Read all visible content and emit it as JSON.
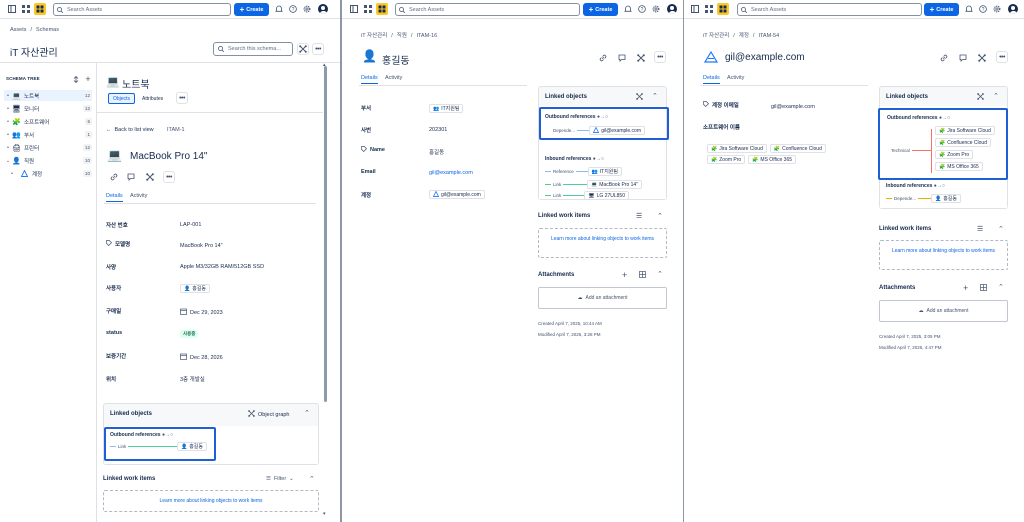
{
  "topbar": {
    "search_placeholder": "Search Assets",
    "create_label": "Create"
  },
  "panel1": {
    "breadcrumb": [
      "Assets",
      "Schemas"
    ],
    "schema_title": "iT 자산관리",
    "schema_search_placeholder": "Search this schema...",
    "schema_tree_label": "SCHEMA TREE",
    "tree": [
      {
        "label": "노트북",
        "count": "12",
        "icon": "laptop-icon",
        "selected": true
      },
      {
        "label": "모니터",
        "count": "12",
        "icon": "monitor-icon"
      },
      {
        "label": "소프트웨어",
        "count": "6",
        "icon": "software-icon"
      },
      {
        "label": "부서",
        "count": "1",
        "icon": "department-icon"
      },
      {
        "label": "프린터",
        "count": "12",
        "icon": "printer-icon"
      },
      {
        "label": "직원",
        "count": "10",
        "icon": "employee-icon",
        "expanded": true
      },
      {
        "label": "계정",
        "count": "10",
        "icon": "account-icon",
        "child": true
      }
    ],
    "type_title": "노트북",
    "type_tabs": {
      "objects": "Objects",
      "attributes": "Attributes"
    },
    "back_label": "Back to list view",
    "object_key": "ITAM-1",
    "object_title": "MacBook Pro 14\"",
    "detail_tabs": {
      "details": "Details",
      "activity": "Activity"
    },
    "attributes": [
      {
        "label": "자산 번호",
        "value": "LAP-001"
      },
      {
        "label": "모델명",
        "value": "MacBook Pro 14\""
      },
      {
        "label": "사양",
        "value": "Apple M3/32GB RAM/512GB SSD"
      },
      {
        "label": "사용자",
        "value": "홍길동"
      },
      {
        "label": "구매일",
        "value": "Dec 29, 2023"
      },
      {
        "label": "status",
        "value": "사용중"
      },
      {
        "label": "보증기간",
        "value": "Dec 28, 2026"
      },
      {
        "label": "위치",
        "value": "3층 개발실"
      }
    ],
    "linked_objects_title": "Linked objects",
    "object_graph_label": "Object graph",
    "outbound_title": "Outbound references",
    "outbound_link_label": "Link",
    "outbound_target": "홍길동",
    "work_items_title": "Linked work items",
    "filter_label": "Filter",
    "work_items_link": "Learn more about linking objects to work items"
  },
  "panel2": {
    "breadcrumb": [
      "iT 자산관리",
      "직원",
      "ITAM-16"
    ],
    "object_title": "홍길동",
    "detail_tabs": {
      "details": "Details",
      "activity": "Activity"
    },
    "attributes": [
      {
        "label": "부서",
        "value": "IT지원팀"
      },
      {
        "label": "사번",
        "value": "202301"
      },
      {
        "label": "Name",
        "value": "홍길동"
      },
      {
        "label": "Email",
        "value": "gil@example.com"
      },
      {
        "label": "계정",
        "value": "gil@example.com"
      }
    ],
    "linked_objects_title": "Linked objects",
    "outbound_title": "Outbound references",
    "outbound_label": "Depende...",
    "outbound_target": "gil@example.com",
    "inbound_title": "Inbound references",
    "inbound": [
      {
        "label": "Reference",
        "targets": [
          "IT지원팀"
        ]
      },
      {
        "label": "Link",
        "targets": [
          "MacBook Pro 14\"",
          "LG 27UL850"
        ]
      }
    ],
    "work_items_title": "Linked work items",
    "work_items_link": "Learn more about linking objects to work items",
    "attachments_title": "Attachments",
    "add_attachment": "Add an attachment",
    "created": "Created April 7, 2025, 10:44 AM",
    "modified": "Modified April 7, 2025, 3:28 PM"
  },
  "panel3": {
    "breadcrumb": [
      "iT 자산관리",
      "계정",
      "ITAM-54"
    ],
    "object_title": "gil@example.com",
    "detail_tabs": {
      "details": "Details",
      "activity": "Activity"
    },
    "email_label": "계정 이메일",
    "email_value": "gil@example.com",
    "software_label": "소프트웨어 이름",
    "software": [
      "Jira Software Cloud",
      "Confluence Cloud",
      "Zoom Pro",
      "MS Office 365"
    ],
    "linked_objects_title": "Linked objects",
    "outbound_title": "Outbound references",
    "outbound_label": "Technical",
    "outbound_targets": [
      "Jira Software Cloud",
      "Confluence Cloud",
      "Zoom Pro",
      "MS Office 365"
    ],
    "inbound_title": "Inbound references",
    "inbound_label": "Depende...",
    "inbound_target": "홍길동",
    "work_items_title": "Linked work items",
    "work_items_link": "Learn more about linking objects to work items",
    "attachments_title": "Attachments",
    "add_attachment": "Add an attachment",
    "created": "Created April 7, 2025, 3:05 PM",
    "modified": "Modified April 7, 2025, 4:47 PM"
  }
}
